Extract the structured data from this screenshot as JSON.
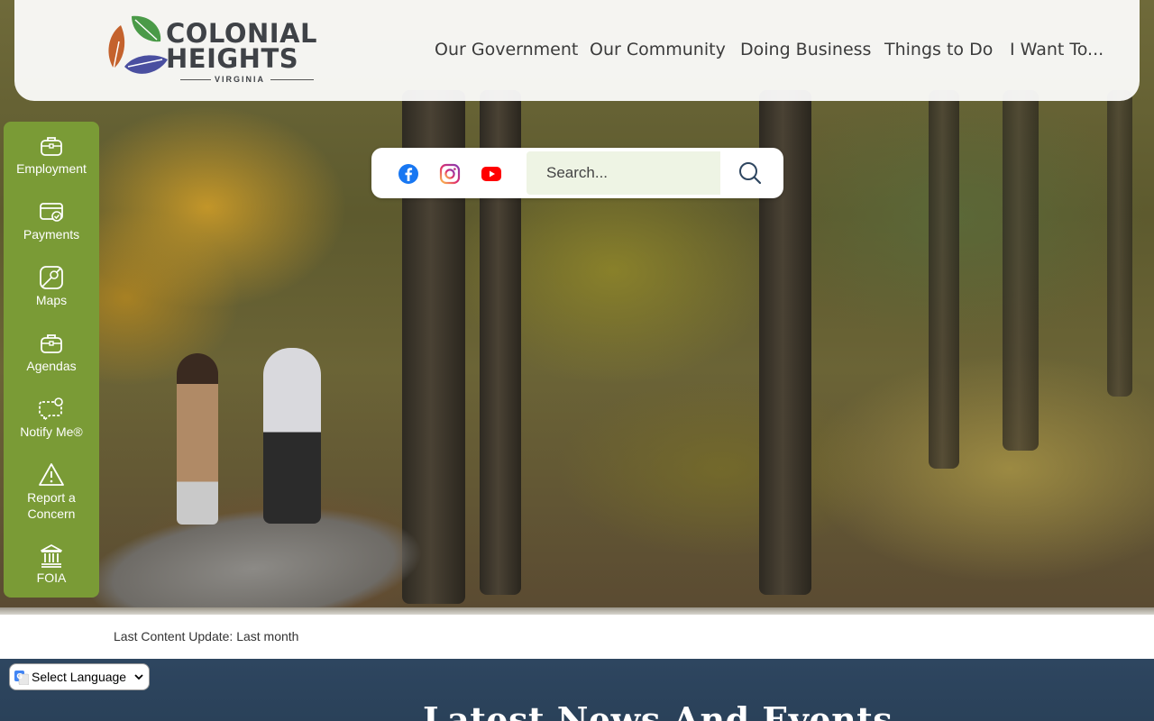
{
  "site": {
    "logo_line1": "COLONIAL",
    "logo_line2": "HEIGHTS",
    "logo_sub": "VIRGINIA"
  },
  "nav": {
    "items": [
      {
        "label": "Our Government"
      },
      {
        "label": "Our Community"
      },
      {
        "label": "Doing Business"
      },
      {
        "label": "Things to Do"
      },
      {
        "label": "I Want To..."
      }
    ]
  },
  "quick_links": [
    {
      "label": "Employment",
      "icon": "briefcase-icon"
    },
    {
      "label": "Payments",
      "icon": "payment-card-icon"
    },
    {
      "label": "Maps",
      "icon": "map-icon"
    },
    {
      "label": "Agendas",
      "icon": "briefcase-icon"
    },
    {
      "label": "Notify Me®",
      "icon": "chat-notify-icon"
    },
    {
      "label": "Report a",
      "label2": "Concern",
      "icon": "warning-icon"
    },
    {
      "label": "FOIA",
      "icon": "building-icon"
    }
  ],
  "search": {
    "placeholder": "Search...",
    "social": [
      "facebook-icon",
      "instagram-icon",
      "youtube-icon"
    ]
  },
  "update": {
    "text": "Last Content Update: Last month"
  },
  "news": {
    "title": "Latest News And Events"
  },
  "language": {
    "selected": "Select Language"
  },
  "colors": {
    "sidebar": "#7a9b36",
    "news_bg": "#2e4660",
    "facebook": "#1877f2",
    "youtube": "#ff0000"
  }
}
